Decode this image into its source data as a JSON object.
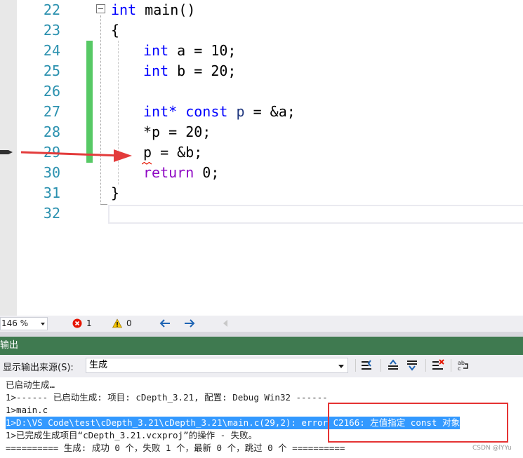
{
  "editor": {
    "lines": [
      {
        "num": "22",
        "code": "main()"
      },
      {
        "num": "23",
        "code": "{"
      },
      {
        "num": "24",
        "code": " a = 10;"
      },
      {
        "num": "25",
        "code": " b = 20;"
      },
      {
        "num": "26",
        "code": ""
      },
      {
        "num": "27",
        "code": "&a;"
      },
      {
        "num": "28",
        "code": "*p = 20;"
      },
      {
        "num": "29",
        "code": "p = &b;"
      },
      {
        "num": "30",
        "code": " 0;"
      },
      {
        "num": "31",
        "code": "}"
      },
      {
        "num": "32",
        "code": ""
      }
    ],
    "kw_int": "int",
    "kw_intptr": "int*",
    "kw_const": "const",
    "var_p": "p",
    "op_eq": " = ",
    "kw_return": "return",
    "var_a": "a",
    "var_b": "b"
  },
  "status": {
    "zoom": "146 %",
    "errors": "1",
    "warnings": "0"
  },
  "output": {
    "title": "输出",
    "source_label": "显示输出来源(S):",
    "source_value": "生成",
    "lines": [
      "已启动生成…",
      "1>------ 已启动生成: 项目: cDepth_3.21, 配置: Debug Win32 ------",
      "1>main.c",
      "1>D:\\VS Code\\test\\cDepth_3.21\\cDepth_3.21\\main.c(29,2): error C2166: 左值指定 const 对象",
      "1>已完成生成项目“cDepth_3.21.vcxproj”的操作 - 失败。",
      "========== 生成: 成功 0 个，失败 1 个，最新 0 个，跳过 0 个 =========="
    ]
  },
  "watermark": "CSDN @lYYu",
  "colors": {
    "keyword": "#0000ff",
    "return_keyword": "#8f08c4",
    "line_number": "#2b91af",
    "change_bar": "#57c965",
    "output_title_bg": "#3f7a50",
    "selection": "#3399ff",
    "highlight_box": "#e53333"
  }
}
